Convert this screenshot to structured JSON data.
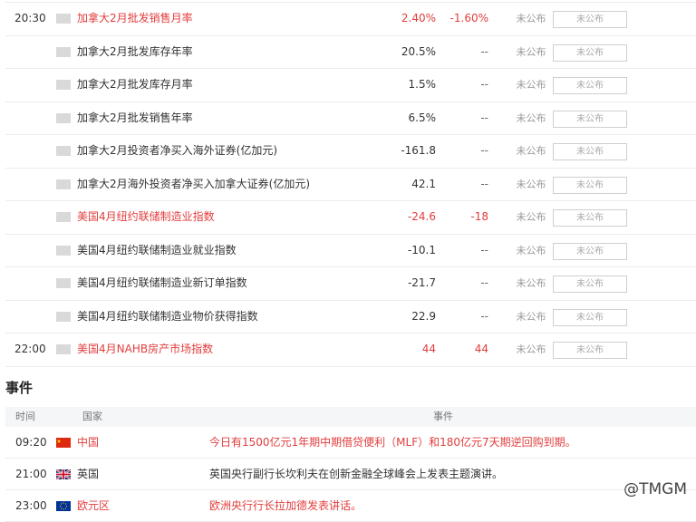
{
  "indicators": [
    {
      "time": "20:30",
      "name": "加拿大2月批发销售月率",
      "actual": "2.40%",
      "previous": "-1.60%",
      "status": "未公布",
      "button": "未公布",
      "highlight": true
    },
    {
      "time": "",
      "name": "加拿大2月批发库存年率",
      "actual": "20.5%",
      "previous": "--",
      "status": "未公布",
      "button": "未公布",
      "highlight": false
    },
    {
      "time": "",
      "name": "加拿大2月批发库存月率",
      "actual": "1.5%",
      "previous": "--",
      "status": "未公布",
      "button": "未公布",
      "highlight": false
    },
    {
      "time": "",
      "name": "加拿大2月批发销售年率",
      "actual": "6.5%",
      "previous": "--",
      "status": "未公布",
      "button": "未公布",
      "highlight": false
    },
    {
      "time": "",
      "name": "加拿大2月投资者净买入海外证券(亿加元)",
      "actual": "-161.8",
      "previous": "--",
      "status": "未公布",
      "button": "未公布",
      "highlight": false
    },
    {
      "time": "",
      "name": "加拿大2月海外投资者净买入加拿大证券(亿加元)",
      "actual": "42.1",
      "previous": "--",
      "status": "未公布",
      "button": "未公布",
      "highlight": false
    },
    {
      "time": "",
      "name": "美国4月纽约联储制造业指数",
      "actual": "-24.6",
      "previous": "-18",
      "status": "未公布",
      "button": "未公布",
      "highlight": true
    },
    {
      "time": "",
      "name": "美国4月纽约联储制造业就业指数",
      "actual": "-10.1",
      "previous": "--",
      "status": "未公布",
      "button": "未公布",
      "highlight": false
    },
    {
      "time": "",
      "name": "美国4月纽约联储制造业新订单指数",
      "actual": "-21.7",
      "previous": "--",
      "status": "未公布",
      "button": "未公布",
      "highlight": false
    },
    {
      "time": "",
      "name": "美国4月纽约联储制造业物价获得指数",
      "actual": "22.9",
      "previous": "--",
      "status": "未公布",
      "button": "未公布",
      "highlight": false
    },
    {
      "time": "22:00",
      "name": "美国4月NAHB房产市场指数",
      "actual": "44",
      "previous": "44",
      "status": "未公布",
      "button": "未公布",
      "highlight": true
    }
  ],
  "events_section": {
    "title": "事件",
    "headers": {
      "time": "时间",
      "country": "国家",
      "event": "事件"
    },
    "rows": [
      {
        "time": "09:20",
        "country": "中国",
        "flag": "china-flag-icon",
        "event": "今日有1500亿元1年期中期借贷便利（MLF）和180亿元7天期逆回购到期。",
        "highlight": true
      },
      {
        "time": "21:00",
        "country": "英国",
        "flag": "uk-flag-icon",
        "event": "英国央行副行长坎利夫在创新金融全球峰会上发表主题演讲。",
        "highlight": false
      },
      {
        "time": "23:00",
        "country": "欧元区",
        "flag": "eu-flag-icon",
        "event": "欧洲央行行长拉加德发表讲话。",
        "highlight": true
      }
    ]
  },
  "watermark": "@TMGM",
  "colors": {
    "highlight": "#e23d3d",
    "border": "#ececec",
    "header_bg": "#f5f6f8"
  }
}
